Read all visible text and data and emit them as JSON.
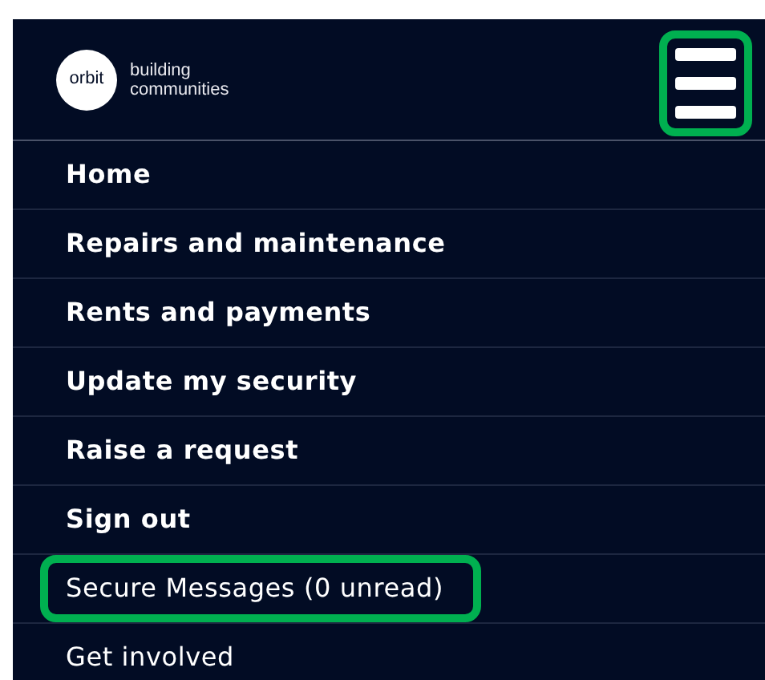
{
  "logo": {
    "mark": "orbit",
    "tagline": [
      "building",
      "communities"
    ]
  },
  "menu_button": {
    "highlighted": true
  },
  "menu": [
    {
      "label": "Home",
      "kind": "main",
      "highlighted": false
    },
    {
      "label": "Repairs and maintenance",
      "kind": "main",
      "highlighted": false
    },
    {
      "label": "Rents and payments",
      "kind": "main",
      "highlighted": false
    },
    {
      "label": "Update my security",
      "kind": "main",
      "highlighted": false
    },
    {
      "label": "Raise a request",
      "kind": "main",
      "highlighted": false
    },
    {
      "label": "Sign out",
      "kind": "main",
      "highlighted": false
    },
    {
      "label": "Secure Messages (0 unread)",
      "kind": "extra",
      "highlighted": true
    },
    {
      "label": "Get involved",
      "kind": "extra",
      "highlighted": false
    }
  ]
}
